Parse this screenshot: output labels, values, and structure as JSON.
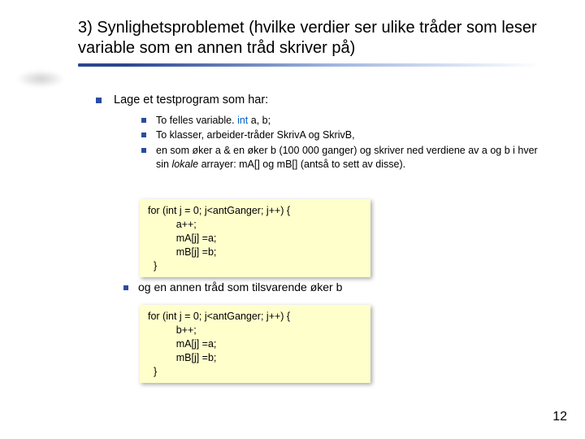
{
  "title": "3) Synlighetsproblemet (hvilke verdier ser ulike tråder som leser variable som en annen tråd skriver på)",
  "bullets": {
    "main": "Lage et testprogram som har:",
    "sub": [
      {
        "pre": "To felles variable. ",
        "kw": "int",
        "post": " a, b;"
      },
      {
        "text": "To klasser, arbeider-tråder SkrivA og SkrivB,"
      },
      {
        "pre": "en som øker a & en øker b (100 000 ganger) og skriver ned verdiene av a og b i hver sin ",
        "ital": "lokale",
        "post": " arrayer: mA[] og mB[] (antså to sett av disse)."
      }
    ],
    "after": "og en annen tråd som tilsvarende øker b"
  },
  "code1": "for (int j = 0; j<antGanger; j++) {\n          a++;\n          mA[j] =a;\n          mB[j] =b;\n  }",
  "code2": "for (int j = 0; j<antGanger; j++) {\n          b++;\n          mA[j] =a;\n          mB[j] =b;\n  }",
  "page": "12"
}
